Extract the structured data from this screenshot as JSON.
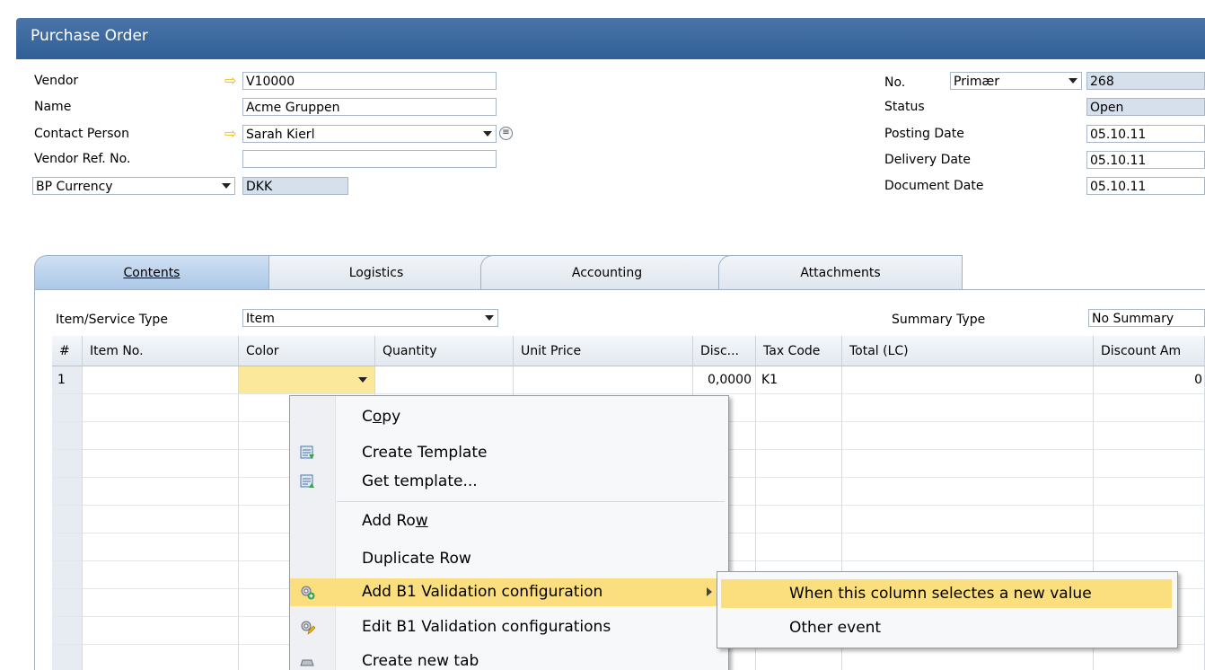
{
  "window": {
    "title": "Purchase Order"
  },
  "header_left": {
    "vendor_label": "Vendor",
    "vendor_value": "V10000",
    "name_label": "Name",
    "name_value": "Acme Gruppen",
    "contact_label": "Contact Person",
    "contact_value": "Sarah Kierl",
    "vendor_ref_label": "Vendor Ref. No.",
    "vendor_ref_value": "",
    "currency_label": "BP Currency",
    "currency_value": "DKK"
  },
  "header_right": {
    "no_label": "No.",
    "series_value": "Primær",
    "no_value": "268",
    "status_label": "Status",
    "status_value": "Open",
    "posting_label": "Posting Date",
    "posting_value": "05.10.11",
    "delivery_label": "Delivery Date",
    "delivery_value": "05.10.11",
    "document_label": "Document Date",
    "document_value": "05.10.11"
  },
  "tabs": [
    {
      "label": "Contents"
    },
    {
      "label": "Logistics"
    },
    {
      "label": "Accounting"
    },
    {
      "label": "Attachments"
    }
  ],
  "contents": {
    "item_type_label": "Item/Service Type",
    "item_type_value": "Item",
    "summary_label": "Summary Type",
    "summary_value": "No Summary"
  },
  "grid": {
    "columns": [
      "#",
      "Item No.",
      "Color",
      "Quantity",
      "Unit Price",
      "Disc...",
      "Tax Code",
      "Total (LC)",
      "Discount Am"
    ],
    "row1": {
      "num": "1",
      "discount": "0,0000",
      "tax_code": "K1",
      "discount_amount": "0"
    }
  },
  "context_menu": {
    "items": [
      {
        "label_pre": "C",
        "label_ul": "o",
        "label_post": "py"
      },
      {
        "label": "Create Template",
        "icon": "template-icon"
      },
      {
        "label": "Get template...",
        "icon": "template-icon"
      },
      {
        "label_pre": "Add Ro",
        "label_ul": "w",
        "label_post": ""
      },
      {
        "label": "Duplicate Row"
      },
      {
        "label": "Add B1 Validation configuration",
        "icon": "gear-add-icon"
      },
      {
        "label": "Edit B1 Validation configurations",
        "icon": "gear-edit-icon"
      },
      {
        "label": "Create new tab",
        "icon": "tab-icon"
      }
    ],
    "submenu": [
      {
        "label": "When this column selectes a new value"
      },
      {
        "label": "Other event"
      }
    ]
  },
  "colors": {
    "titlebar": "#2f5f97",
    "highlight": "#fbdf7e",
    "selected_cell": "#fbe89a",
    "link_arrow": "#f1b800"
  }
}
